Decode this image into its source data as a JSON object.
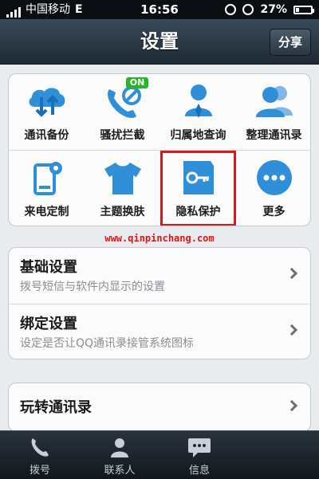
{
  "status_bar": {
    "carrier": "中国移动",
    "network": "E",
    "time": "16:56",
    "battery": "27%"
  },
  "header": {
    "title": "设置",
    "share_label": "分享"
  },
  "tiles": [
    {
      "label": "通讯备份",
      "icon": "cloud-sync-icon"
    },
    {
      "label": "骚扰拦截",
      "icon": "phone-block-icon",
      "badge": "ON"
    },
    {
      "label": "归属地查询",
      "icon": "person-location-icon"
    },
    {
      "label": "整理通讯录",
      "icon": "contacts-group-icon"
    },
    {
      "label": "来电定制",
      "icon": "phone-settings-icon"
    },
    {
      "label": "主题换肤",
      "icon": "tshirt-icon"
    },
    {
      "label": "隐私保护",
      "icon": "key-icon",
      "highlighted": true
    },
    {
      "label": "更多",
      "icon": "more-icon"
    }
  ],
  "watermark": "www.qinpinchang.com",
  "settings": [
    {
      "title": "基础设置",
      "subtitle": "拨号短信与软件内显示的设置"
    },
    {
      "title": "绑定设置",
      "subtitle": "设定是否让QQ通讯录接管系统图标"
    },
    {
      "title": "玩转通讯录"
    }
  ],
  "tab_bar": [
    {
      "label": "拨号",
      "icon": "phone-icon"
    },
    {
      "label": "联系人",
      "icon": "contact-icon"
    },
    {
      "label": "信息",
      "icon": "message-icon"
    }
  ],
  "colors": {
    "accent_blue": "#2f8fd8",
    "highlight_red": "#e01515",
    "on_badge_green": "#2ab42a"
  }
}
